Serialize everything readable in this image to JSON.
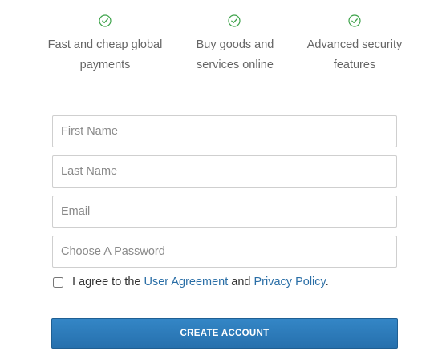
{
  "features": [
    {
      "line1": "Fast and cheap global",
      "line2": "payments",
      "icon": "check-circle-icon"
    },
    {
      "line1": "Buy goods and",
      "line2": "services online",
      "icon": "check-circle-icon"
    },
    {
      "line1": "Advanced security",
      "line2": "features",
      "icon": "check-circle-icon"
    }
  ],
  "form": {
    "first_name_placeholder": "First Name",
    "last_name_placeholder": "Last Name",
    "email_placeholder": "Email",
    "password_placeholder": "Choose A Password",
    "agree_prefix": "I agree to the ",
    "user_agreement_link": "User Agreement",
    "agree_and": " and ",
    "privacy_policy_link": "Privacy Policy",
    "agree_suffix": ".",
    "agree_checked": false,
    "submit_label": "CREATE ACCOUNT"
  },
  "colors": {
    "check_green": "#3da34a",
    "link_blue": "#2a6ea6",
    "button_blue": "#2b78b9"
  }
}
